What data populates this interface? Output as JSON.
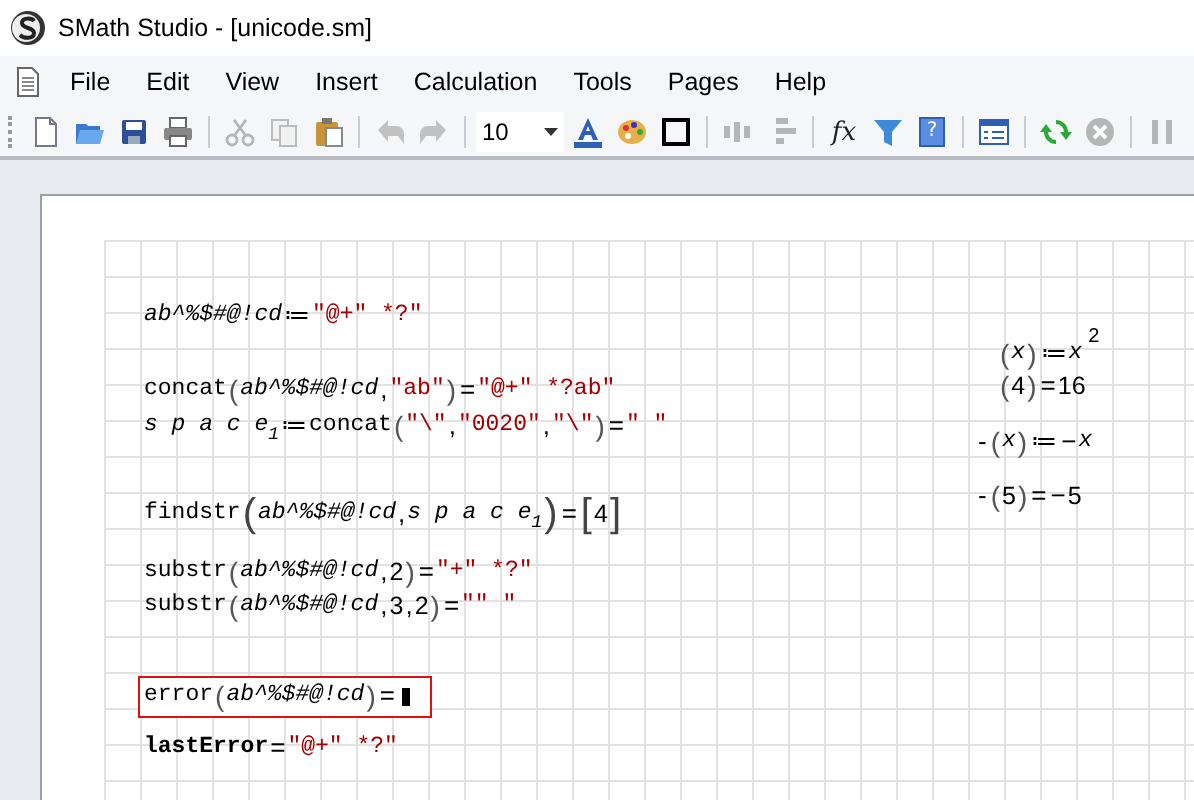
{
  "window": {
    "title": "SMath Studio - [unicode.sm]"
  },
  "menu": [
    "File",
    "Edit",
    "View",
    "Insert",
    "Calculation",
    "Tools",
    "Pages",
    "Help"
  ],
  "toolbar": {
    "buttons": [
      {
        "disabled": false
      },
      {
        "disabled": false
      },
      {
        "disabled": false
      },
      {
        "disabled": false
      },
      {
        "disabled": true
      },
      {
        "disabled": true
      },
      {
        "disabled": false
      },
      {
        "disabled": true
      },
      {
        "disabled": true
      },
      {
        "disabled": false
      },
      {
        "disabled": false
      },
      {
        "disabled": false
      },
      {
        "disabled": true
      },
      {
        "disabled": true
      },
      {
        "disabled": false,
        "label": "fx"
      },
      {
        "disabled": false
      },
      {
        "disabled": false,
        "label": "?"
      },
      {
        "disabled": false
      },
      {
        "disabled": false
      },
      {
        "disabled": true
      },
      {
        "disabled": true
      }
    ],
    "font_size": "10"
  },
  "regions": [
    {
      "error": false,
      "tokens": [
        {
          "kind": "var",
          "text": "ab^%$#@!cd"
        },
        {
          "kind": "op",
          "text": "≔"
        },
        {
          "kind": "str",
          "text": "\"@+\" *?\""
        }
      ]
    },
    {
      "error": false,
      "tokens": [
        {
          "kind": "fn",
          "text": "concat"
        },
        {
          "kind": "paren",
          "text": "("
        },
        {
          "kind": "var",
          "text": "ab^%$#@!cd"
        },
        {
          "kind": "op",
          "text": ","
        },
        {
          "kind": "str",
          "text": "\"ab\""
        },
        {
          "kind": "paren",
          "text": ")"
        },
        {
          "kind": "op",
          "text": "="
        },
        {
          "kind": "str",
          "text": "\"@+\" *?ab\""
        }
      ]
    },
    {
      "error": false,
      "tokens": [
        {
          "kind": "var",
          "text": "s p a c e"
        },
        {
          "kind": "sub",
          "text": "1"
        },
        {
          "kind": "op",
          "text": "≔"
        },
        {
          "kind": "fn",
          "text": "concat"
        },
        {
          "kind": "paren",
          "text": "("
        },
        {
          "kind": "str",
          "text": "\"\\\""
        },
        {
          "kind": "op",
          "text": ","
        },
        {
          "kind": "str",
          "text": "\"0020\""
        },
        {
          "kind": "op",
          "text": ","
        },
        {
          "kind": "str",
          "text": "\"\\\""
        },
        {
          "kind": "paren",
          "text": ")"
        },
        {
          "kind": "op",
          "text": "="
        },
        {
          "kind": "str",
          "text": "\" \""
        }
      ]
    },
    {
      "error": false,
      "tokens": [
        {
          "kind": "fn",
          "text": "findstr"
        },
        {
          "kind": "bigparen",
          "text": "("
        },
        {
          "kind": "var",
          "text": "ab^%$#@!cd"
        },
        {
          "kind": "op",
          "text": ","
        },
        {
          "kind": "var",
          "text": "s p a c e"
        },
        {
          "kind": "sub",
          "text": "1"
        },
        {
          "kind": "bigparen",
          "text": ")"
        },
        {
          "kind": "op",
          "text": "="
        },
        {
          "kind": "bigparen",
          "text": "["
        },
        {
          "kind": "num",
          "text": "4"
        },
        {
          "kind": "bigparen",
          "text": "]"
        }
      ]
    },
    {
      "error": false,
      "tokens": [
        {
          "kind": "fn",
          "text": "substr"
        },
        {
          "kind": "paren",
          "text": "("
        },
        {
          "kind": "var",
          "text": "ab^%$#@!cd"
        },
        {
          "kind": "op",
          "text": ","
        },
        {
          "kind": "num",
          "text": "2"
        },
        {
          "kind": "paren",
          "text": ")"
        },
        {
          "kind": "op",
          "text": "="
        },
        {
          "kind": "str",
          "text": "\"+\" *?\""
        }
      ]
    },
    {
      "error": false,
      "tokens": [
        {
          "kind": "fn",
          "text": "substr"
        },
        {
          "kind": "paren",
          "text": "("
        },
        {
          "kind": "var",
          "text": "ab^%$#@!cd"
        },
        {
          "kind": "op",
          "text": ","
        },
        {
          "kind": "num",
          "text": "3"
        },
        {
          "kind": "op",
          "text": ","
        },
        {
          "kind": "num",
          "text": "2"
        },
        {
          "kind": "paren",
          "text": ")"
        },
        {
          "kind": "op",
          "text": "="
        },
        {
          "kind": "str",
          "text": "\"\" \""
        }
      ]
    },
    {
      "error": true,
      "tokens": [
        {
          "kind": "fn",
          "text": "error"
        },
        {
          "kind": "paren",
          "text": "("
        },
        {
          "kind": "var",
          "text": "ab^%$#@!cd"
        },
        {
          "kind": "paren",
          "text": ")"
        },
        {
          "kind": "op",
          "text": "="
        },
        {
          "kind": "cursor"
        }
      ]
    },
    {
      "error": false,
      "tokens": [
        {
          "kind": "bold",
          "text": "lastError"
        },
        {
          "kind": "op",
          "text": "="
        },
        {
          "kind": "str",
          "text": "\"@+\" *?\""
        }
      ]
    },
    {
      "error": false,
      "tokens": [
        {
          "kind": "paren",
          "text": "("
        },
        {
          "kind": "var",
          "text": "x"
        },
        {
          "kind": "paren",
          "text": ")"
        },
        {
          "kind": "op",
          "text": "≔"
        },
        {
          "kind": "var",
          "text": "x"
        },
        {
          "kind": "sup",
          "text": "2"
        }
      ]
    },
    {
      "error": false,
      "tokens": [
        {
          "kind": "paren",
          "text": "("
        },
        {
          "kind": "num",
          "text": "4"
        },
        {
          "kind": "paren",
          "text": ")"
        },
        {
          "kind": "op",
          "text": "="
        },
        {
          "kind": "num",
          "text": "16"
        }
      ]
    },
    {
      "error": false,
      "tokens": [
        {
          "kind": "op",
          "text": "-"
        },
        {
          "kind": "paren",
          "text": "("
        },
        {
          "kind": "var",
          "text": "x"
        },
        {
          "kind": "paren",
          "text": ")"
        },
        {
          "kind": "op",
          "text": "≔"
        },
        {
          "kind": "op",
          "text": "−"
        },
        {
          "kind": "var",
          "text": "x"
        }
      ]
    },
    {
      "error": false,
      "tokens": [
        {
          "kind": "op",
          "text": "-"
        },
        {
          "kind": "paren",
          "text": "("
        },
        {
          "kind": "num",
          "text": "5"
        },
        {
          "kind": "paren",
          "text": ")"
        },
        {
          "kind": "op",
          "text": "="
        },
        {
          "kind": "op",
          "text": "−"
        },
        {
          "kind": "num",
          "text": "5"
        }
      ]
    }
  ]
}
